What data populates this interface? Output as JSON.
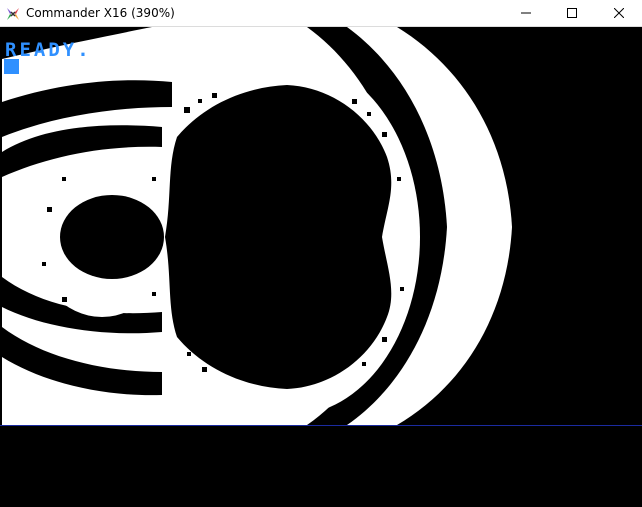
{
  "window": {
    "title": "Commander X16 (390%)",
    "icon": "commander-x16-icon",
    "controls": [
      "minimize-icon",
      "maximize-icon",
      "close-icon"
    ]
  },
  "screen": {
    "ready_text": "READY.",
    "text_color": "#2f90ff",
    "background": "#000000",
    "divider_color": "#1b2ba0",
    "content": "mandelbrot-fractal"
  }
}
